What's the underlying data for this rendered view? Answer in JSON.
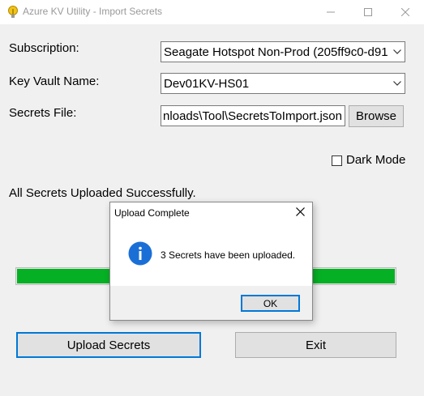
{
  "window": {
    "title": "Azure KV Utility - Import Secrets",
    "icons": {
      "app": "key-bulb-icon",
      "minimize": "minimize-icon",
      "maximize": "maximize-icon",
      "close": "close-icon"
    }
  },
  "form": {
    "subscription_label": "Subscription:",
    "subscription_value": "Seagate Hotspot Non-Prod (205ff9c0-d91",
    "keyvault_label": "Key Vault Name:",
    "keyvault_value": "Dev01KV-HS01",
    "secrets_file_label": "Secrets File:",
    "secrets_file_value": "nloads\\Tool\\SecretsToImport.json",
    "browse_label": "Browse",
    "dark_mode_label": "Dark Mode",
    "dark_mode_checked": false
  },
  "status": {
    "text": "All Secrets Uploaded Successfully.",
    "progress_percent": 100,
    "progress_color": "#06b025"
  },
  "actions": {
    "upload_label": "Upload Secrets",
    "exit_label": "Exit"
  },
  "dialog": {
    "title": "Upload Complete",
    "message": "3 Secrets have been uploaded.",
    "ok_label": "OK",
    "icon": "info-icon",
    "icon_color": "#1a6fd6"
  },
  "colors": {
    "accent": "#0078d7",
    "window_bg": "#f0f0f0"
  }
}
